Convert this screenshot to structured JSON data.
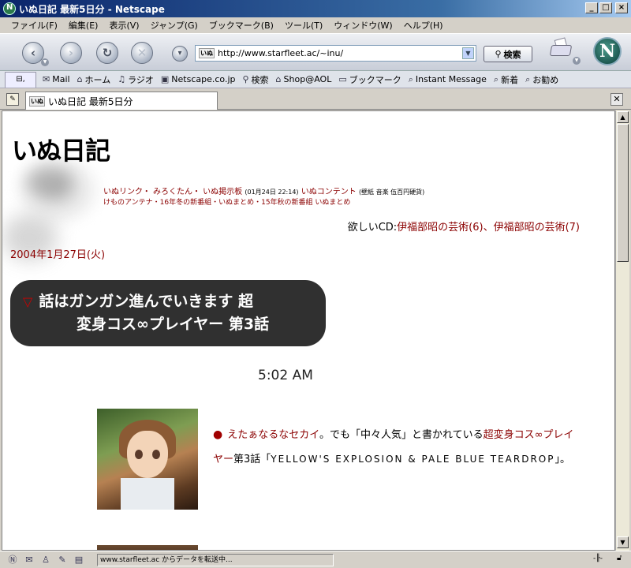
{
  "window": {
    "title": "いぬ日記 最新5日分 - Netscape",
    "min_label": "_",
    "max_label": "□",
    "close_label": "×"
  },
  "menu": [
    "ファイル(F)",
    "編集(E)",
    "表示(V)",
    "ジャンプ(G)",
    "ブックマーク(B)",
    "ツール(T)",
    "ウィンドウ(W)",
    "ヘルプ(H)"
  ],
  "nav": {
    "url": "http://www.starfleet.ac/~inu/",
    "url_favicon": "いぬ",
    "search_label": "検索",
    "netscape_logo": "N"
  },
  "bookmarks": [
    {
      "icon": "mail-icon",
      "glyph": "✉",
      "label": "Mail"
    },
    {
      "icon": "home-icon",
      "glyph": "⌂",
      "label": "ホーム"
    },
    {
      "icon": "radio-icon",
      "glyph": "♫",
      "label": "ラジオ"
    },
    {
      "icon": "my-icon",
      "glyph": "▣",
      "label": "Netscape.co.jp"
    },
    {
      "icon": "search-icon",
      "glyph": "⚲",
      "label": "検索"
    },
    {
      "icon": "shop-icon",
      "glyph": "⌂",
      "label": "Shop@AOL"
    },
    {
      "icon": "folder-icon",
      "glyph": "▭",
      "label": "ブックマーク"
    },
    {
      "icon": "bookmark-icon",
      "glyph": "⌕",
      "label": "Instant Message"
    },
    {
      "icon": "bookmark-icon",
      "glyph": "⌕",
      "label": "新着"
    },
    {
      "icon": "bookmark-icon",
      "glyph": "⌕",
      "label": "お勧め"
    }
  ],
  "tab": {
    "favicon": "いぬ",
    "label": "いぬ日記 最新5日分"
  },
  "page": {
    "site_title": "いぬ日記",
    "links_line1_a": "いぬリンク・ みろくたん・ いぬ掲示板",
    "links_line1_b": "(01月24日 22:14)",
    "links_line1_c": "いぬコンテント",
    "links_line1_d": "(壁紙 音楽 伍百円硬貨)",
    "links_line2": "けものアンテナ・16年冬の新番組・いぬまとめ・15年秋の新番組 いぬまとめ",
    "wanted_prefix": "欲しいCD:",
    "wanted_links": "伊福部昭の芸術(6)、伊福部昭の芸術(7)",
    "date": "2004年1月27日(火)",
    "entry_title_line1": "話はガンガン進んでいきます 超",
    "entry_title_line2": "変身コス∞プレイヤー 第3話",
    "entry_marker": "▽",
    "time": "5:02 AM",
    "body_bullet": "●",
    "body_link1": "えたぁなるなセカイ",
    "body_text1": "。でも「中々人気」と書かれている",
    "body_link2": "超変身コス∞プレイヤー",
    "body_text2": "第3話「",
    "body_roman": "YELLOW'S EXPLOSION & PALE BLUE TEARDROP",
    "body_text3": "」。"
  },
  "status": {
    "text": "www.starfleet.ac からデータを転送中..."
  }
}
